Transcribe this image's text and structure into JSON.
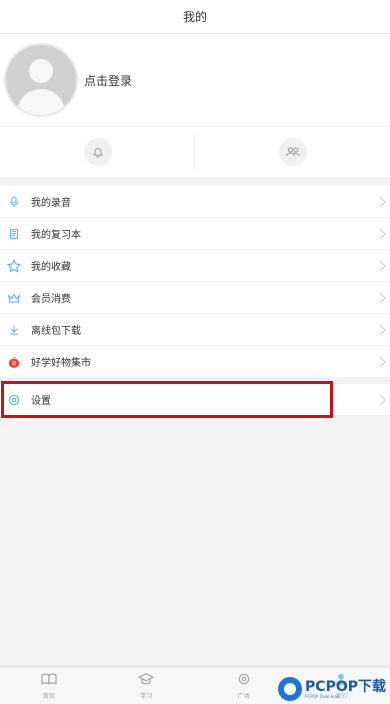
{
  "header": {
    "title": "我的"
  },
  "profile": {
    "login_text": "点击登录"
  },
  "quick_actions": {
    "notifications_icon": "bell-icon",
    "friends_icon": "users-icon"
  },
  "menu": [
    {
      "label": "我的录音",
      "icon": "microphone-icon"
    },
    {
      "label": "我的复习本",
      "icon": "notebook-icon"
    },
    {
      "label": "我的收藏",
      "icon": "star-icon"
    },
    {
      "label": "会员消费",
      "icon": "crown-icon"
    },
    {
      "label": "离线包下载",
      "icon": "download-icon"
    },
    {
      "label": "好学好物集市",
      "icon": "shop-bag-icon"
    }
  ],
  "settings": {
    "label": "设置",
    "icon": "gear-icon"
  },
  "bottom_nav": [
    {
      "label": "首页",
      "icon": "book-icon",
      "active": false
    },
    {
      "label": "学习",
      "icon": "graduation-cap-icon",
      "active": false
    },
    {
      "label": "广场",
      "icon": "square-icon",
      "active": false
    },
    {
      "label": "我的",
      "icon": "profile-icon",
      "active": true
    }
  ],
  "watermark": {
    "main": "PCPOP下载",
    "sub": "PCPOP Download"
  },
  "colors": {
    "accent_blue": "#59b7e6",
    "highlight_red": "#c8111b",
    "background": "#f3f3f3"
  }
}
